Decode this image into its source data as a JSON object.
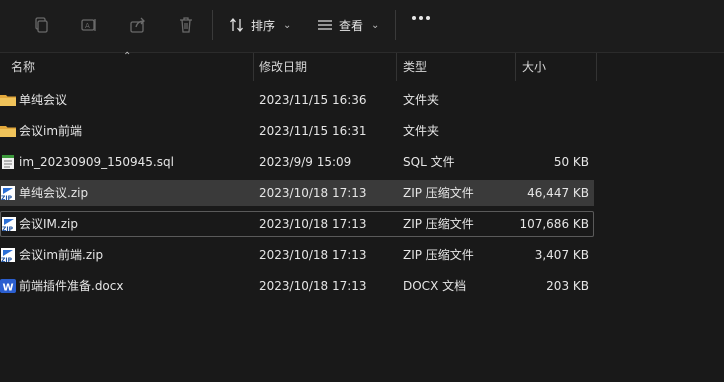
{
  "toolbar": {
    "copy_icon": "copy-icon",
    "rename_icon": "rename-icon",
    "share_icon": "share-icon",
    "delete_icon": "delete-icon",
    "sort_label": "排序",
    "view_label": "查看",
    "more_icon": "more-icon"
  },
  "columns": {
    "name": "名称",
    "modified": "修改日期",
    "type": "类型",
    "size": "大小"
  },
  "files": [
    {
      "name": "单纯会议",
      "modified": "2023/11/15 16:36",
      "type": "文件夹",
      "size": "",
      "icon": "folder-icon"
    },
    {
      "name": "会议im前端",
      "modified": "2023/11/15 16:31",
      "type": "文件夹",
      "size": "",
      "icon": "folder-icon"
    },
    {
      "name": "im_20230909_150945.sql",
      "modified": "2023/9/9 15:09",
      "type": "SQL 文件",
      "size": "50 KB",
      "icon": "sql-file-icon"
    },
    {
      "name": "单纯会议.zip",
      "modified": "2023/10/18 17:13",
      "type": "ZIP 压缩文件",
      "size": "46,447 KB",
      "icon": "zip-file-icon"
    },
    {
      "name": "会议IM.zip",
      "modified": "2023/10/18 17:13",
      "type": "ZIP 压缩文件",
      "size": "107,686 KB",
      "icon": "zip-file-icon"
    },
    {
      "name": "会议im前端.zip",
      "modified": "2023/10/18 17:13",
      "type": "ZIP 压缩文件",
      "size": "3,407 KB",
      "icon": "zip-file-icon"
    },
    {
      "name": "前端插件准备.docx",
      "modified": "2023/10/18 17:13",
      "type": "DOCX 文档",
      "size": "203 KB",
      "icon": "word-doc-icon"
    }
  ],
  "colors": {
    "background": "#191919",
    "selected_row": "#3a3a3a",
    "folder": "#f0c35a",
    "zip_blue": "#2b6fd6",
    "word_blue": "#2b5fd0"
  }
}
